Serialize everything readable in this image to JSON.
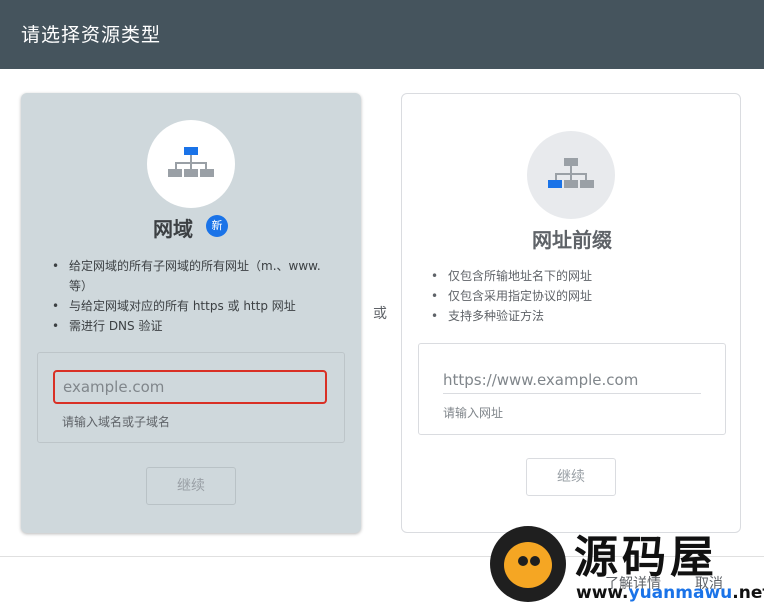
{
  "header": {
    "title": "请选择资源类型"
  },
  "domain_card": {
    "title": "网域",
    "badge": "新",
    "bullets": [
      "给定网域的所有子网域的所有网址（m.、www. 等）",
      "与给定网域对应的所有 https 或 http 网址",
      "需进行 DNS 验证"
    ],
    "input": {
      "placeholder": "example.com",
      "value": ""
    },
    "hint": "请输入域名或子域名",
    "button": "继续"
  },
  "separator": "或",
  "prefix_card": {
    "title": "网址前缀",
    "bullets": [
      "仅包含所输地址名下的网址",
      "仅包含采用指定协议的网址",
      "支持多种验证方法"
    ],
    "input": {
      "placeholder": "https://www.example.com",
      "value": ""
    },
    "hint": "请输入网址",
    "button": "继续"
  },
  "footer": {
    "learn_more": "了解详情",
    "cancel": "取消"
  },
  "watermark": {
    "title": "源码屋",
    "url_prefix": "www.",
    "url_brand": "yuanmawu",
    "url_suffix": ".net"
  },
  "colors": {
    "header_bg": "#45545d",
    "selected_card_bg": "#cfd8dc",
    "accent": "#1a73e8",
    "error_border": "#d93025"
  },
  "icons": {
    "domain": "sitemap-icon",
    "prefix": "sitemap-icon"
  }
}
